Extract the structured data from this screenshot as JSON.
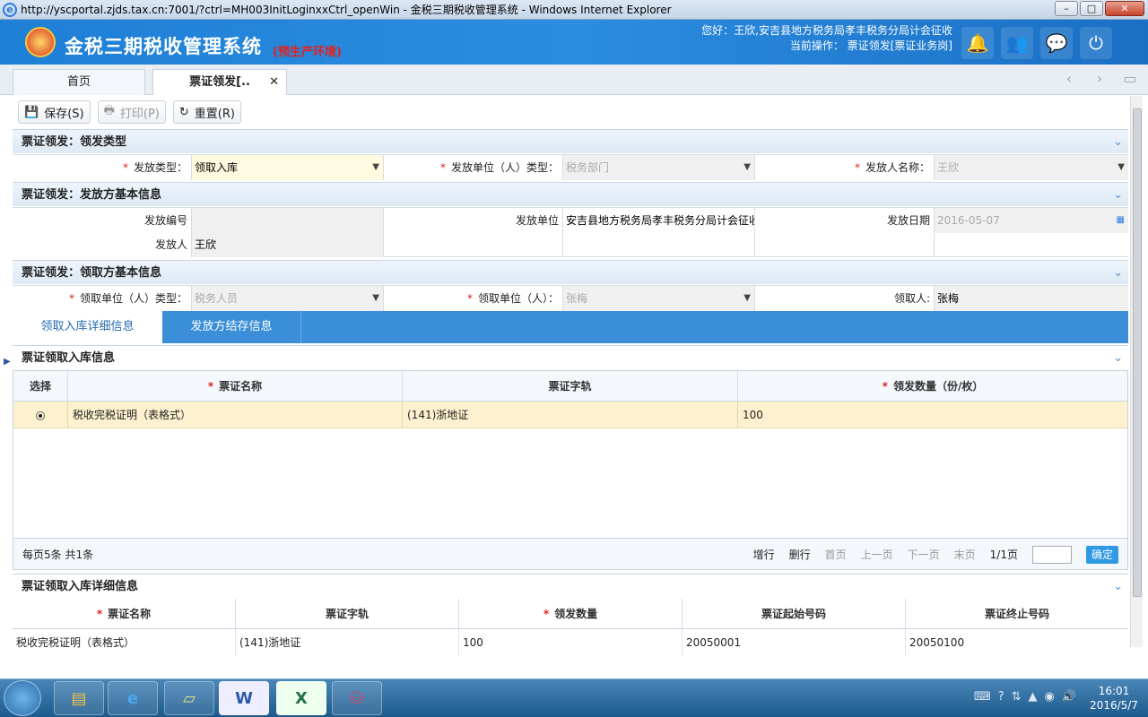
{
  "window": {
    "title": "http://yscportal.zjds.tax.cn:7001/?ctrl=MH003InitLoginxxCtrl_openWin - 金税三期税收管理系统 - Windows Internet Explorer"
  },
  "header": {
    "app_title": "金税三期税收管理系统",
    "env_label": "(预生产环境)",
    "user_line": "您好：王欣,安吉县地方税务局孝丰税务分局计会征收",
    "op_line": "当前操作： 票证领发[票证业务岗]"
  },
  "tabs": {
    "home": "首页",
    "active": "票证领发[.."
  },
  "toolbar": {
    "save": "保存(S)",
    "print": "打印(P)",
    "reset": "重置(R)"
  },
  "sec1": {
    "title": "票证领发：领发类型",
    "issue_type_label": "发放类型：",
    "issue_type_value": "领取入库",
    "issuer_unit_type_label": "发放单位（人）类型：",
    "issuer_unit_type_value": "税务部门",
    "issuer_name_label": "发放人名称：",
    "issuer_name_value": "王欣"
  },
  "sec2": {
    "title": "票证领发：发放方基本信息",
    "issue_no_label": "发放编号",
    "issue_no_value": "",
    "issuer_unit_label": "发放单位",
    "issuer_unit_value": "安吉县地方税务局孝丰税务分局计会征收",
    "issue_date_label": "发放日期",
    "issue_date_value": "2016-05-07",
    "issuer_label": "发放人",
    "issuer_value": "王欣"
  },
  "sec3": {
    "title": "票证领发：领取方基本信息",
    "recv_unit_type_label": "领取单位（人）类型：",
    "recv_unit_type_value": "税务人员",
    "recv_unit_label": "领取单位（人）：",
    "recv_unit_value": "张梅",
    "receiver_label": "领取人:",
    "receiver_value": "张梅"
  },
  "subtabs": {
    "tab1": "领取入库详细信息",
    "tab2": "发放方结存信息"
  },
  "grid1": {
    "title": "票证领取入库信息",
    "headers": [
      "选择",
      "票证名称",
      "票证字轨",
      "领发数量（份/枚）"
    ],
    "rows": [
      {
        "name": "税收完税证明（表格式）",
        "track": "(141)浙地证",
        "qty": "100"
      }
    ]
  },
  "pager": {
    "per_page": "每页5条 共1条",
    "add": "增行",
    "del": "删行",
    "first": "首页",
    "prev": "上一页",
    "next": "下一页",
    "last": "末页",
    "page": "1/1页",
    "ok": "确定"
  },
  "grid2": {
    "title": "票证领取入库详细信息",
    "headers": [
      "票证名称",
      "票证字轨",
      "领发数量",
      "票证起始号码",
      "票证终止号码"
    ],
    "row": [
      "税收完税证明（表格式）",
      "(141)浙地证",
      "100",
      "20050001",
      "20050100"
    ]
  },
  "taskbar": {
    "time": "16:01",
    "date": "2016/5/7"
  }
}
